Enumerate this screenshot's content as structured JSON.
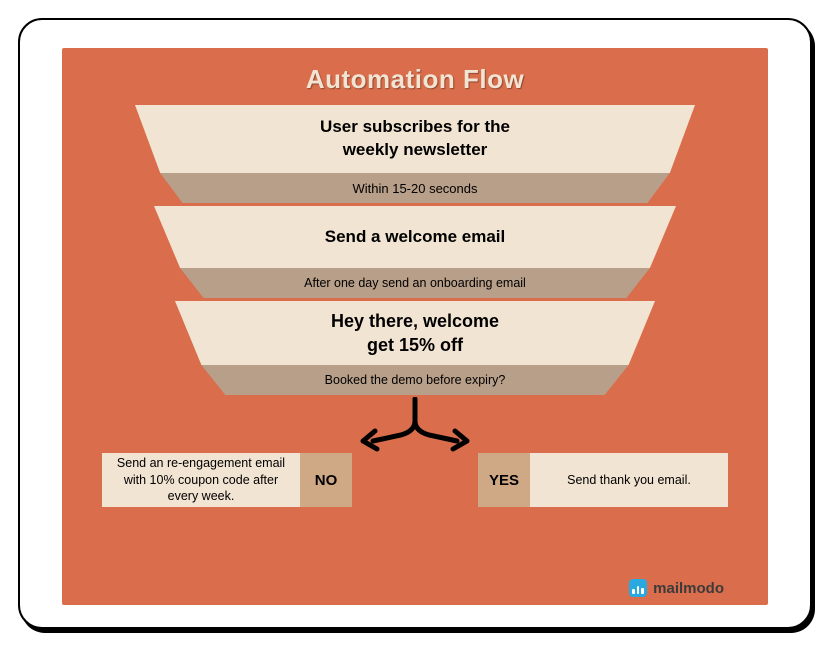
{
  "title": "Automation Flow",
  "funnel": [
    {
      "top": "User subscribes for the\nweekly newsletter",
      "bottom": "Within 15-20 seconds"
    },
    {
      "top": "Send a welcome email",
      "bottom": "After one day send an onboarding email"
    },
    {
      "top": "Hey there, welcome\nget 15% off",
      "bottom": "Booked the demo before expiry?"
    }
  ],
  "branches": {
    "no": {
      "tag": "NO",
      "text": "Send an re-engagement email with 10% coupon code after every week."
    },
    "yes": {
      "tag": "YES",
      "text": "Send thank you email."
    }
  },
  "brand": "mailmodo"
}
